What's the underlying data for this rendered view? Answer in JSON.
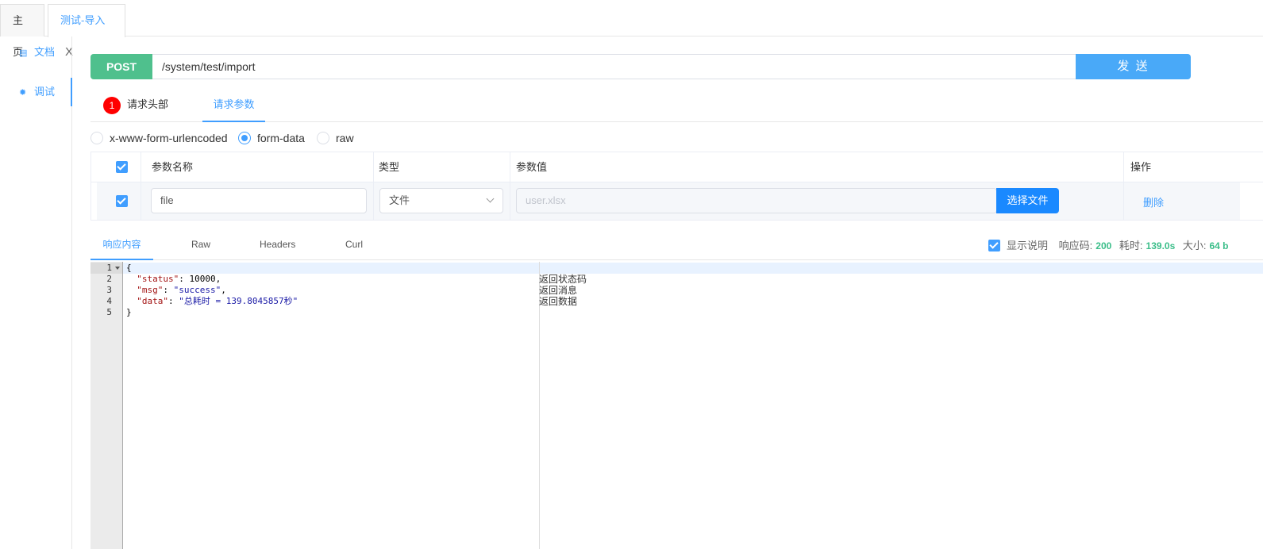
{
  "tabs": [
    {
      "label": "主页"
    },
    {
      "label": "测试-导入",
      "close": "X"
    }
  ],
  "sidebar": {
    "items": [
      {
        "label": "文档",
        "icon": "document-icon"
      },
      {
        "label": "调试",
        "icon": "bug-icon"
      }
    ]
  },
  "request": {
    "method": "POST",
    "url": "/system/test/import",
    "send_label": "发 送"
  },
  "subtabs": {
    "headers_label": "请求头部",
    "headers_count": "1",
    "params_label": "请求参数"
  },
  "body_types": {
    "options": [
      "x-www-form-urlencoded",
      "form-data",
      "raw"
    ],
    "selected": "form-data"
  },
  "params_table": {
    "headers": [
      "参数名称",
      "类型",
      "参数值",
      "操作"
    ],
    "rows": [
      {
        "checked": true,
        "name": "file",
        "type": "文件",
        "value_placeholder": "user.xlsx",
        "choose_label": "选择文件",
        "action": "删除"
      }
    ]
  },
  "response": {
    "tabs": [
      "响应内容",
      "Raw",
      "Headers",
      "Curl"
    ],
    "show_notes_label": "显示说明",
    "code_label": "响应码:",
    "code_value": "200",
    "time_label": "耗时:",
    "time_value": "139.0s",
    "size_label": "大小:",
    "size_value": "64 b",
    "lines": [
      {
        "num": "1",
        "code": "{"
      },
      {
        "num": "2",
        "key": "\"status\"",
        "value": "10000",
        "note": "返回状态码"
      },
      {
        "num": "3",
        "key": "\"msg\"",
        "value": "\"success\"",
        "note": "返回消息"
      },
      {
        "num": "4",
        "key": "\"data\"",
        "value": "\"总耗时 = 139.8045857秒\"",
        "note": "返回数据"
      },
      {
        "num": "5",
        "code": "}"
      }
    ]
  },
  "colors": {
    "accent": "#409eff",
    "method_bg": "#4fc08d",
    "send_bg": "#49a9f8",
    "badge": "#ff0000",
    "status_green": "#3cbe8a"
  }
}
